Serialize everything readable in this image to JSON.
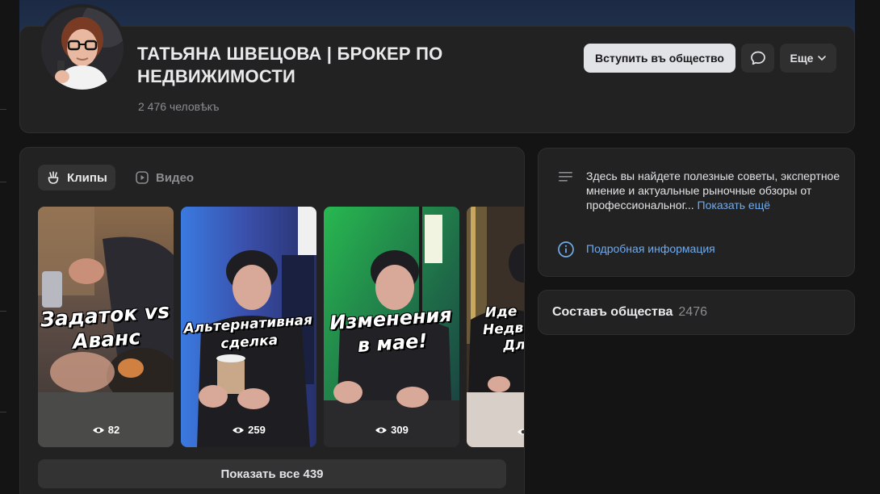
{
  "group": {
    "title": "ТАТЬЯНА ШВЕЦОВА | БРОКЕР ПО НЕДВИЖИМОСТИ",
    "members": "2 476 человѣкъ"
  },
  "actions": {
    "join_label": "Вступить въ общество",
    "more_label": "Еще"
  },
  "clips_section": {
    "tabs": [
      {
        "label": "Клипы",
        "icon": "clips-icon",
        "active": true
      },
      {
        "label": "Видео",
        "icon": "video-icon",
        "active": false
      }
    ],
    "clips": [
      {
        "title_line1": "Задаток vs",
        "title_line2": "Аванс",
        "views": "82"
      },
      {
        "title_line1": "Альтернативная",
        "title_line2": "сделка",
        "views": "259"
      },
      {
        "title_line1": "Изменения",
        "title_line2": "в мае!",
        "views": "309"
      },
      {
        "title_line1": "Иде",
        "title_line2": "Недви",
        "title_line3": "Дл",
        "views": ""
      }
    ],
    "show_all_label": "Показать все 439"
  },
  "info": {
    "description": "Здесь вы найдете полезные советы, экспертное мнение и актуальные рыночные обзоры от профессиональног...",
    "show_more": "Показать ещё",
    "details_link": "Подробная информация"
  },
  "composition": {
    "title": "Составъ общества",
    "count": "2476"
  },
  "colors": {
    "background": "#141414",
    "card": "#222222",
    "accent_link": "#71aaeb",
    "primary_button": "#e1e3e6"
  }
}
